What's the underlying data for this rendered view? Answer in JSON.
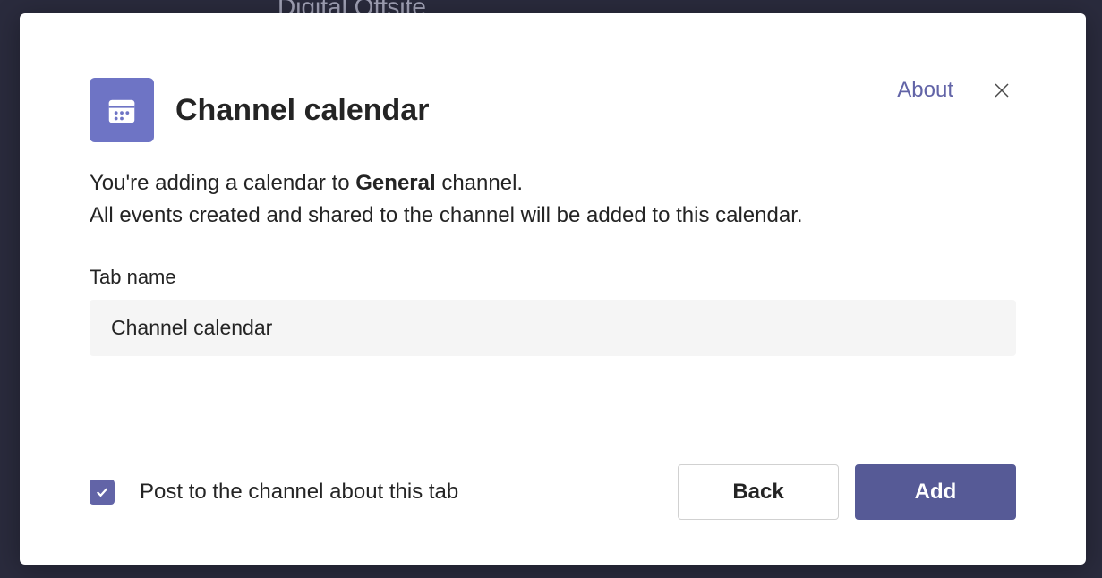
{
  "backdrop": {
    "channel_glimpse": "Digital Offsite"
  },
  "modal": {
    "title": "Channel calendar",
    "about_label": "About",
    "description": {
      "line1_pre": "You're adding a calendar to ",
      "line1_bold": "General",
      "line1_post": " channel.",
      "line2": "All events created and shared to the channel will be added to this calendar."
    },
    "tab_name_field": {
      "label": "Tab name",
      "value": "Channel calendar"
    },
    "post_checkbox": {
      "checked": true,
      "label": "Post to the channel about this tab"
    },
    "buttons": {
      "back": "Back",
      "add": "Add"
    }
  }
}
